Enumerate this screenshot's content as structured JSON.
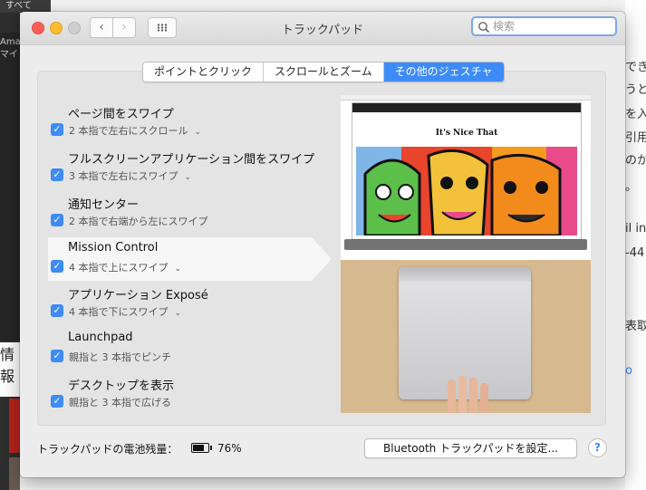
{
  "background": {
    "left_top": "すべて",
    "left_mid": [
      "Ama",
      "マイ"
    ],
    "left_low": "情報",
    "right_lines": [
      "でき",
      "うと",
      "を入",
      "引用",
      "のか",
      "。",
      "il in",
      "-44",
      "表取",
      "o"
    ]
  },
  "window": {
    "title": "トラックパッド",
    "search_placeholder": "検索"
  },
  "tabs": [
    {
      "label": "ポイントとクリック",
      "active": false
    },
    {
      "label": "スクロールとズーム",
      "active": false
    },
    {
      "label": "その他のジェスチャ",
      "active": true
    }
  ],
  "gestures": [
    {
      "label": "ページ間をスワイプ",
      "sub": "2 本指で左右にスクロール",
      "checked": true,
      "has_menu": true
    },
    {
      "label": "フルスクリーンアプリケーション間をスワイプ",
      "sub": "3 本指で左右にスワイプ",
      "checked": true,
      "has_menu": true
    },
    {
      "label": "通知センター",
      "sub": "2 本指で右端から左にスワイプ",
      "checked": true,
      "has_menu": false
    },
    {
      "label": "Mission Control",
      "sub": "4 本指で上にスワイプ",
      "checked": true,
      "has_menu": true,
      "selected": true
    },
    {
      "label": "アプリケーション Exposé",
      "sub": "4 本指で下にスワイプ",
      "checked": true,
      "has_menu": true
    },
    {
      "label": "Launchpad",
      "sub": "親指と 3 本指でピンチ",
      "checked": true,
      "has_menu": false
    },
    {
      "label": "デスクトップを表示",
      "sub": "親指と 3 本指で広げる",
      "checked": true,
      "has_menu": false
    }
  ],
  "preview": {
    "site_title": "It's Nice That"
  },
  "footer": {
    "battery_label": "トラックパッドの電池残量：",
    "battery_percent_text": "76%",
    "battery_level": 0.76,
    "bluetooth_button": "Bluetooth トラックパッドを設定...",
    "help": "?"
  },
  "colors": {
    "accent": "#3d8bf6",
    "close": "#fc5f57",
    "minimize": "#fdbc2e"
  }
}
